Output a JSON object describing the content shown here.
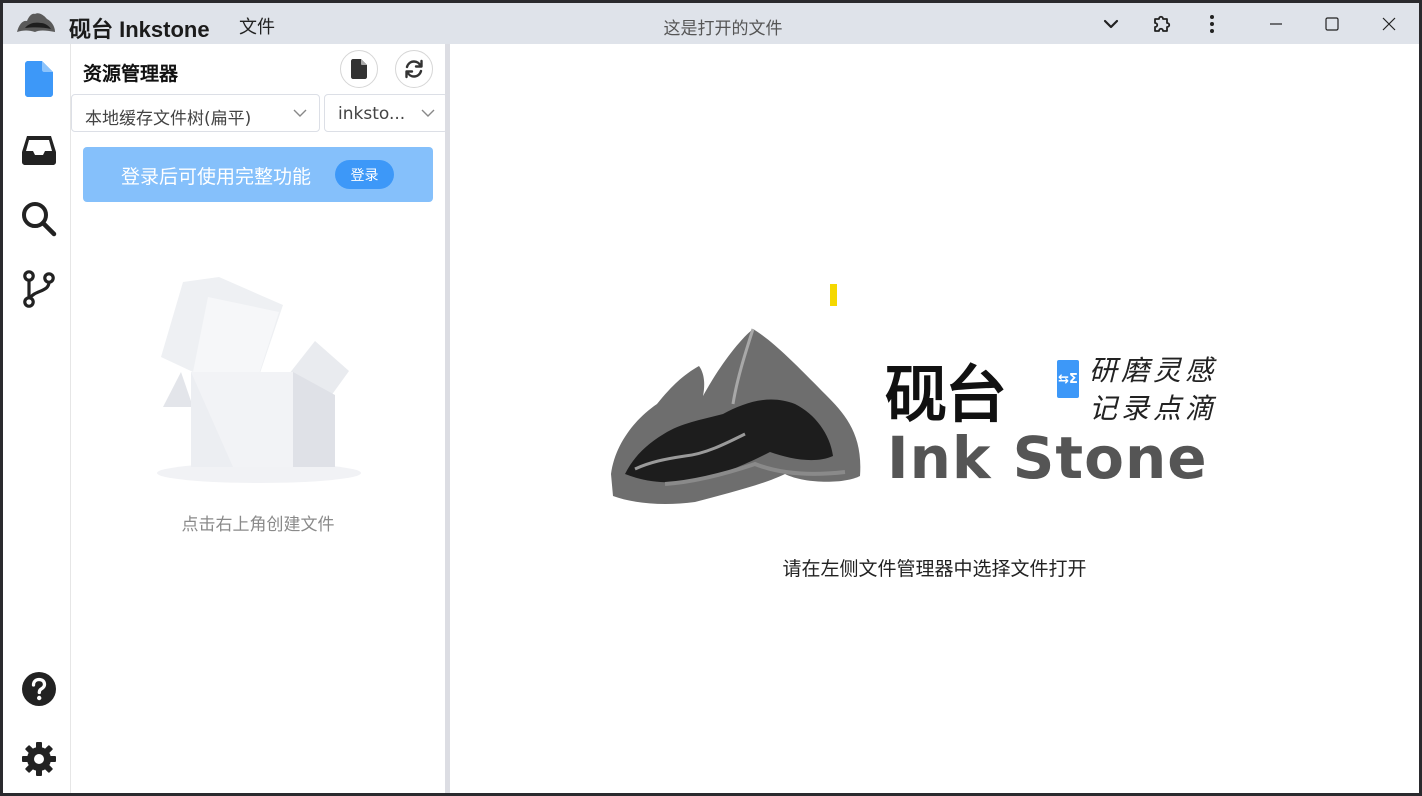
{
  "app": {
    "title": "砚台 Inkstone",
    "menu_file": "文件",
    "open_file_title": "这是打开的文件"
  },
  "titlebar_icons": [
    "chevron-down-icon",
    "extension-icon",
    "more-vert-icon",
    "minimize-icon",
    "maximize-icon",
    "close-icon"
  ],
  "activity_bar": {
    "items": [
      "file-icon",
      "inbox-icon",
      "search-icon",
      "git-branch-icon"
    ],
    "bottom": [
      "help-icon",
      "settings-icon"
    ]
  },
  "explorer": {
    "title": "资源管理器",
    "tree_mode": "本地缓存文件树(扁平)",
    "workspace": "inksto...",
    "login_banner_text": "登录后可使用完整功能",
    "login_button": "登录",
    "empty_text": "点击右上角创建文件"
  },
  "main": {
    "brand_cn": "砚台",
    "brand_tag": "⇆Σ",
    "brand_slogan_line1": "研磨灵感",
    "brand_slogan_line2": "记录点滴",
    "brand_en": "Ink Stone",
    "hint": "请在左侧文件管理器中选择文件打开"
  },
  "colors": {
    "titlebar_bg": "#dfe3ea",
    "accent": "#3d98f8",
    "login_banner": "#85c0fb",
    "splitter": "#dcdde3"
  }
}
